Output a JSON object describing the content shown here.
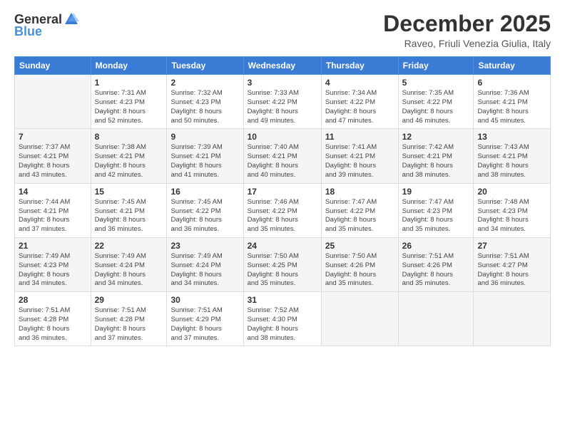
{
  "logo": {
    "text_general": "General",
    "text_blue": "Blue"
  },
  "header": {
    "month": "December 2025",
    "location": "Raveo, Friuli Venezia Giulia, Italy"
  },
  "weekdays": [
    "Sunday",
    "Monday",
    "Tuesday",
    "Wednesday",
    "Thursday",
    "Friday",
    "Saturday"
  ],
  "weeks": [
    [
      {
        "day": "",
        "info": ""
      },
      {
        "day": "1",
        "info": "Sunrise: 7:31 AM\nSunset: 4:23 PM\nDaylight: 8 hours\nand 52 minutes."
      },
      {
        "day": "2",
        "info": "Sunrise: 7:32 AM\nSunset: 4:23 PM\nDaylight: 8 hours\nand 50 minutes."
      },
      {
        "day": "3",
        "info": "Sunrise: 7:33 AM\nSunset: 4:22 PM\nDaylight: 8 hours\nand 49 minutes."
      },
      {
        "day": "4",
        "info": "Sunrise: 7:34 AM\nSunset: 4:22 PM\nDaylight: 8 hours\nand 47 minutes."
      },
      {
        "day": "5",
        "info": "Sunrise: 7:35 AM\nSunset: 4:22 PM\nDaylight: 8 hours\nand 46 minutes."
      },
      {
        "day": "6",
        "info": "Sunrise: 7:36 AM\nSunset: 4:21 PM\nDaylight: 8 hours\nand 45 minutes."
      }
    ],
    [
      {
        "day": "7",
        "info": "Sunrise: 7:37 AM\nSunset: 4:21 PM\nDaylight: 8 hours\nand 43 minutes."
      },
      {
        "day": "8",
        "info": "Sunrise: 7:38 AM\nSunset: 4:21 PM\nDaylight: 8 hours\nand 42 minutes."
      },
      {
        "day": "9",
        "info": "Sunrise: 7:39 AM\nSunset: 4:21 PM\nDaylight: 8 hours\nand 41 minutes."
      },
      {
        "day": "10",
        "info": "Sunrise: 7:40 AM\nSunset: 4:21 PM\nDaylight: 8 hours\nand 40 minutes."
      },
      {
        "day": "11",
        "info": "Sunrise: 7:41 AM\nSunset: 4:21 PM\nDaylight: 8 hours\nand 39 minutes."
      },
      {
        "day": "12",
        "info": "Sunrise: 7:42 AM\nSunset: 4:21 PM\nDaylight: 8 hours\nand 38 minutes."
      },
      {
        "day": "13",
        "info": "Sunrise: 7:43 AM\nSunset: 4:21 PM\nDaylight: 8 hours\nand 38 minutes."
      }
    ],
    [
      {
        "day": "14",
        "info": "Sunrise: 7:44 AM\nSunset: 4:21 PM\nDaylight: 8 hours\nand 37 minutes."
      },
      {
        "day": "15",
        "info": "Sunrise: 7:45 AM\nSunset: 4:21 PM\nDaylight: 8 hours\nand 36 minutes."
      },
      {
        "day": "16",
        "info": "Sunrise: 7:45 AM\nSunset: 4:22 PM\nDaylight: 8 hours\nand 36 minutes."
      },
      {
        "day": "17",
        "info": "Sunrise: 7:46 AM\nSunset: 4:22 PM\nDaylight: 8 hours\nand 35 minutes."
      },
      {
        "day": "18",
        "info": "Sunrise: 7:47 AM\nSunset: 4:22 PM\nDaylight: 8 hours\nand 35 minutes."
      },
      {
        "day": "19",
        "info": "Sunrise: 7:47 AM\nSunset: 4:23 PM\nDaylight: 8 hours\nand 35 minutes."
      },
      {
        "day": "20",
        "info": "Sunrise: 7:48 AM\nSunset: 4:23 PM\nDaylight: 8 hours\nand 34 minutes."
      }
    ],
    [
      {
        "day": "21",
        "info": "Sunrise: 7:49 AM\nSunset: 4:23 PM\nDaylight: 8 hours\nand 34 minutes."
      },
      {
        "day": "22",
        "info": "Sunrise: 7:49 AM\nSunset: 4:24 PM\nDaylight: 8 hours\nand 34 minutes."
      },
      {
        "day": "23",
        "info": "Sunrise: 7:49 AM\nSunset: 4:24 PM\nDaylight: 8 hours\nand 34 minutes."
      },
      {
        "day": "24",
        "info": "Sunrise: 7:50 AM\nSunset: 4:25 PM\nDaylight: 8 hours\nand 35 minutes."
      },
      {
        "day": "25",
        "info": "Sunrise: 7:50 AM\nSunset: 4:26 PM\nDaylight: 8 hours\nand 35 minutes."
      },
      {
        "day": "26",
        "info": "Sunrise: 7:51 AM\nSunset: 4:26 PM\nDaylight: 8 hours\nand 35 minutes."
      },
      {
        "day": "27",
        "info": "Sunrise: 7:51 AM\nSunset: 4:27 PM\nDaylight: 8 hours\nand 36 minutes."
      }
    ],
    [
      {
        "day": "28",
        "info": "Sunrise: 7:51 AM\nSunset: 4:28 PM\nDaylight: 8 hours\nand 36 minutes."
      },
      {
        "day": "29",
        "info": "Sunrise: 7:51 AM\nSunset: 4:28 PM\nDaylight: 8 hours\nand 37 minutes."
      },
      {
        "day": "30",
        "info": "Sunrise: 7:51 AM\nSunset: 4:29 PM\nDaylight: 8 hours\nand 37 minutes."
      },
      {
        "day": "31",
        "info": "Sunrise: 7:52 AM\nSunset: 4:30 PM\nDaylight: 8 hours\nand 38 minutes."
      },
      {
        "day": "",
        "info": ""
      },
      {
        "day": "",
        "info": ""
      },
      {
        "day": "",
        "info": ""
      }
    ]
  ]
}
